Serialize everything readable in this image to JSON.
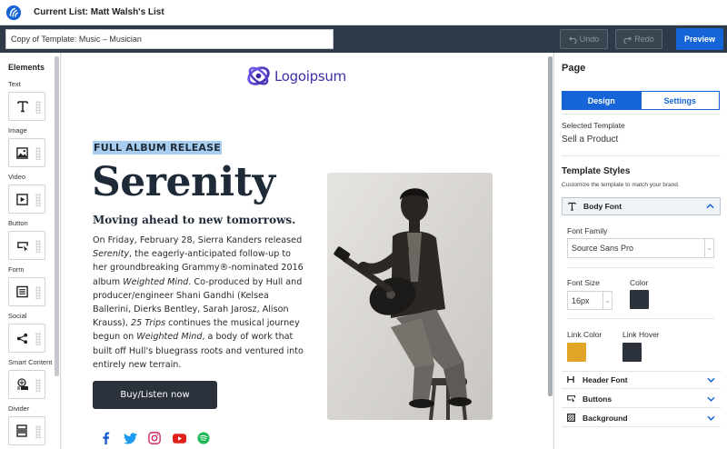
{
  "header": {
    "list_title": "Current List: Matt Walsh's List"
  },
  "toolbar": {
    "template_name": "Copy of Template: Music – Musician",
    "undo_label": "Undo",
    "redo_label": "Redo",
    "preview_label": "Preview"
  },
  "elements": {
    "heading": "Elements",
    "items": [
      {
        "label": "Text",
        "icon": "text-icon"
      },
      {
        "label": "Image",
        "icon": "image-icon"
      },
      {
        "label": "Video",
        "icon": "video-icon"
      },
      {
        "label": "Button",
        "icon": "button-icon"
      },
      {
        "label": "Form",
        "icon": "form-icon"
      },
      {
        "label": "Social",
        "icon": "share-icon"
      },
      {
        "label": "Smart Content",
        "icon": "smart-content-icon"
      },
      {
        "label": "Divider",
        "icon": "divider-icon"
      }
    ]
  },
  "canvas": {
    "brand_name": "Logoipsum",
    "eyebrow": "FULL ALBUM RELEASE",
    "headline": "Serenity",
    "subhead": "Moving ahead to new tomorrows.",
    "body": {
      "p1": "On Friday, February 28, Sierra Kanders released ",
      "em1": "Serenity",
      "p2": ", the eagerly-anticipated follow-up to her groundbreaking Grammy®-nominated 2016 album ",
      "em2": "Weighted Mind",
      "p3": ". Co-produced by Hull and producer/engineer Shani Gandhi (Kelsea Ballerini, Dierks Bentley, Sarah Jarosz, Alison Krauss), ",
      "em3": "25 Trips",
      "p4": " continues the musical journey begun on ",
      "em4": "Weighted Mind",
      "p5": ", a body of work that built off Hull's bluegrass roots and ventured into entirely new terrain."
    },
    "cta_label": "Buy/Listen now",
    "social_icons": [
      "facebook-icon",
      "twitter-icon",
      "instagram-icon",
      "youtube-icon",
      "spotify-icon"
    ]
  },
  "settings": {
    "title": "Page",
    "tabs": {
      "design": "Design",
      "settings": "Settings"
    },
    "selected_template_label": "Selected Template",
    "selected_template_value": "Sell a Product",
    "template_styles_heading": "Template Styles",
    "template_styles_desc": "Customize the template to match your brand.",
    "body_font": {
      "label": "Body Font",
      "font_family_label": "Font Family",
      "font_family_value": "Source Sans Pro",
      "font_size_label": "Font Size",
      "font_size_value": "16px",
      "color_label": "Color",
      "link_color_label": "Link Color",
      "link_hover_label": "Link Hover"
    },
    "sections": {
      "header_font": "Header Font",
      "buttons": "Buttons",
      "background": "Background"
    }
  },
  "colors": {
    "accent": "#1565d8",
    "toolbar_bg": "#2e3a47",
    "text_color": "#2b323b",
    "link_color": "#e0a427",
    "link_hover": "#2b323b"
  }
}
